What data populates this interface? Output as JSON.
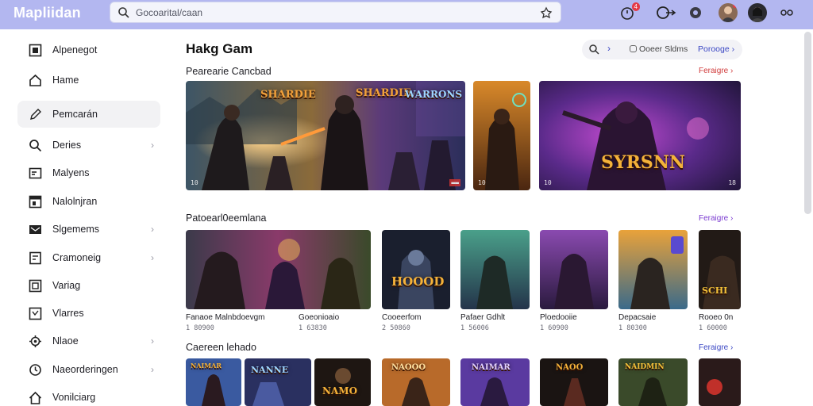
{
  "app": {
    "logo": "Mapliidan"
  },
  "search": {
    "placeholder": "Gocoarital/caan"
  },
  "topbar": {
    "badge_count": "4"
  },
  "sidebar": {
    "items": [
      {
        "label": "Alpenegot",
        "icon": "grid-icon"
      },
      {
        "label": "Hame",
        "icon": "home-icon"
      },
      {
        "label": "Pemcarán",
        "icon": "pen-icon"
      },
      {
        "label": "Deries",
        "icon": "search-icon"
      },
      {
        "label": "Malyens",
        "icon": "calendar-icon"
      },
      {
        "label": "Nalolnjran",
        "icon": "board-icon"
      },
      {
        "label": "Slgemems",
        "icon": "mail-icon"
      },
      {
        "label": "Cramoneig",
        "icon": "doc-icon"
      },
      {
        "label": "Variag",
        "icon": "box-icon"
      },
      {
        "label": "Vlarres",
        "icon": "window-icon"
      },
      {
        "label": "Nlaoe",
        "icon": "gear-icon"
      },
      {
        "label": "Naeorderingen",
        "icon": "clock-icon"
      },
      {
        "label": "Vonilciarg",
        "icon": "house-icon"
      }
    ]
  },
  "main": {
    "title": "Hakg Gam",
    "filters": {
      "pill": "Ooeer Sldms",
      "link": "Porooge"
    },
    "featured": {
      "title": "Pearearie Cancbad",
      "link": "Feraigre",
      "cards": [
        {
          "tag": "SHARDIE",
          "tag2": "WARRONS",
          "cap": "10"
        },
        {
          "cap": "10"
        },
        {
          "logo": "SYRSNN",
          "cap": "10"
        }
      ]
    },
    "popular": {
      "title": "Patoearl0eemlana",
      "link": "Feraigre",
      "tiles": [
        {
          "name": "Fanaoe Malnbdoevgm",
          "sub": "1 80900"
        },
        {
          "name": "Goeonioaio",
          "sub": "1 63830"
        },
        {
          "name": "Cooeerfom",
          "sub": "2 50860"
        },
        {
          "name": "Pafaer Gdhlt",
          "sub": "1 56006"
        },
        {
          "name": "Ploedooiie",
          "sub": "1 60900"
        },
        {
          "name": "Depacsaie",
          "sub": "1 80300"
        },
        {
          "name": "Rooeo 0n",
          "sub": "1 60000"
        }
      ],
      "logo_hood": "HOOOD",
      "logo_sch": "SCHI"
    },
    "recent": {
      "title": "Caereen lehado",
      "link": "Feraigre",
      "logos": [
        "NAIMAR",
        "NANNE",
        "NAMO",
        "NAOOO",
        "NAIMAR",
        "NAOO",
        "NAIDMIN"
      ]
    }
  }
}
